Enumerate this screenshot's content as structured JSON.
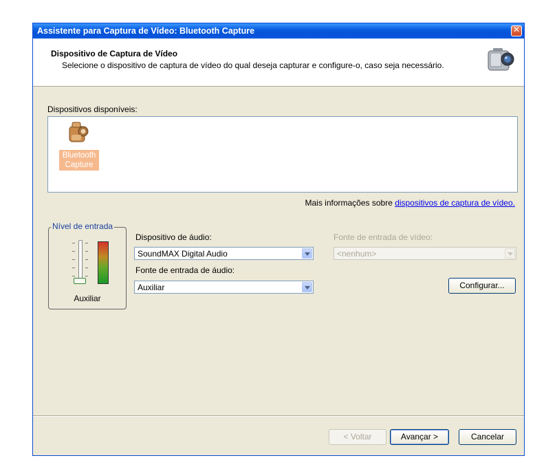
{
  "window": {
    "title": "Assistente para Captura de Vídeo: Bluetooth Capture",
    "close_icon": "close-icon"
  },
  "header": {
    "title": "Dispositivo de Captura de Vídeo",
    "subtitle": "Selecione o dispositivo de captura de vídeo do qual deseja capturar e configure-o, caso seja necessário.",
    "icon": "video-camera-icon"
  },
  "devices": {
    "label": "Dispositivos disponíveis:",
    "items": [
      {
        "label": "Bluetooth Capture",
        "icon": "camera-device-icon",
        "selected": true
      }
    ]
  },
  "more_info": {
    "prefix": "Mais informações sobre ",
    "link": "dispositivos de captura de vídeo."
  },
  "input_level": {
    "legend": "Nível de entrada",
    "caption": "Auxiliar",
    "level": 0.05
  },
  "audio_device": {
    "label": "Dispositivo de áudio:",
    "value": "SoundMAX Digital Audio"
  },
  "audio_source": {
    "label": "Fonte de entrada de áudio:",
    "value": "Auxiliar"
  },
  "video_source": {
    "label": "Fonte de entrada de vídeo:",
    "value": "<nenhum>",
    "disabled": true
  },
  "buttons": {
    "configure": "Configurar...",
    "back": "< Voltar",
    "next": "Avançar >",
    "cancel": "Cancelar"
  },
  "colors": {
    "title_bar": "#0a5fe0",
    "dialog_bg": "#ece9d8",
    "selection": "#f6b98e",
    "link": "#0000ee"
  }
}
